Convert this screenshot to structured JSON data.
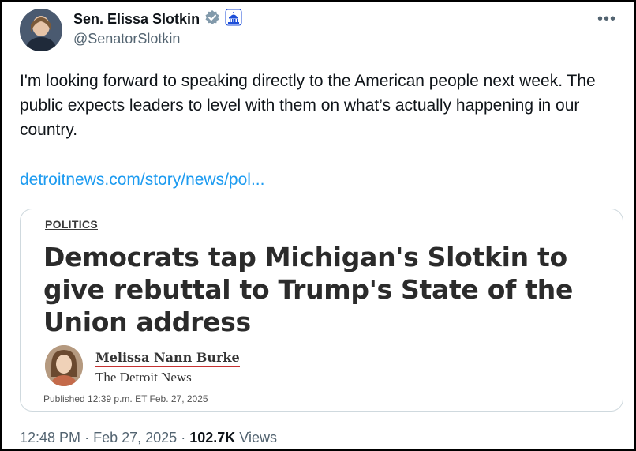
{
  "author": {
    "display_name": "Sen. Elissa Slotkin",
    "handle": "@SenatorSlotkin"
  },
  "icons": {
    "verified": "verified-badge-icon",
    "affiliation": "capitol-icon",
    "more": "more-icon"
  },
  "more_label": "•••",
  "tweet": {
    "text": "I'm looking forward to speaking directly to the American people next week. The public expects leaders to level with them on what’s actually happening in our country.",
    "link": "detroitnews.com/story/news/pol..."
  },
  "card": {
    "section": "POLITICS",
    "headline": "Democrats tap Michigan's Slotkin to give rebuttal to Trump's State of the Union address",
    "author_name": "Melissa Nann Burke",
    "outlet": "The Detroit News",
    "published": "Published 12:39 p.m. ET Feb. 27, 2025"
  },
  "meta": {
    "time": "12:48 PM",
    "separator": "·",
    "date": "Feb 27, 2025",
    "views_count": "102.7K",
    "views_label": "Views"
  },
  "colors": {
    "link": "#1d9bf0",
    "verified_badge": "#829aab",
    "affiliation_badge": "#1d4ed8",
    "author_underline": "#c53030"
  }
}
